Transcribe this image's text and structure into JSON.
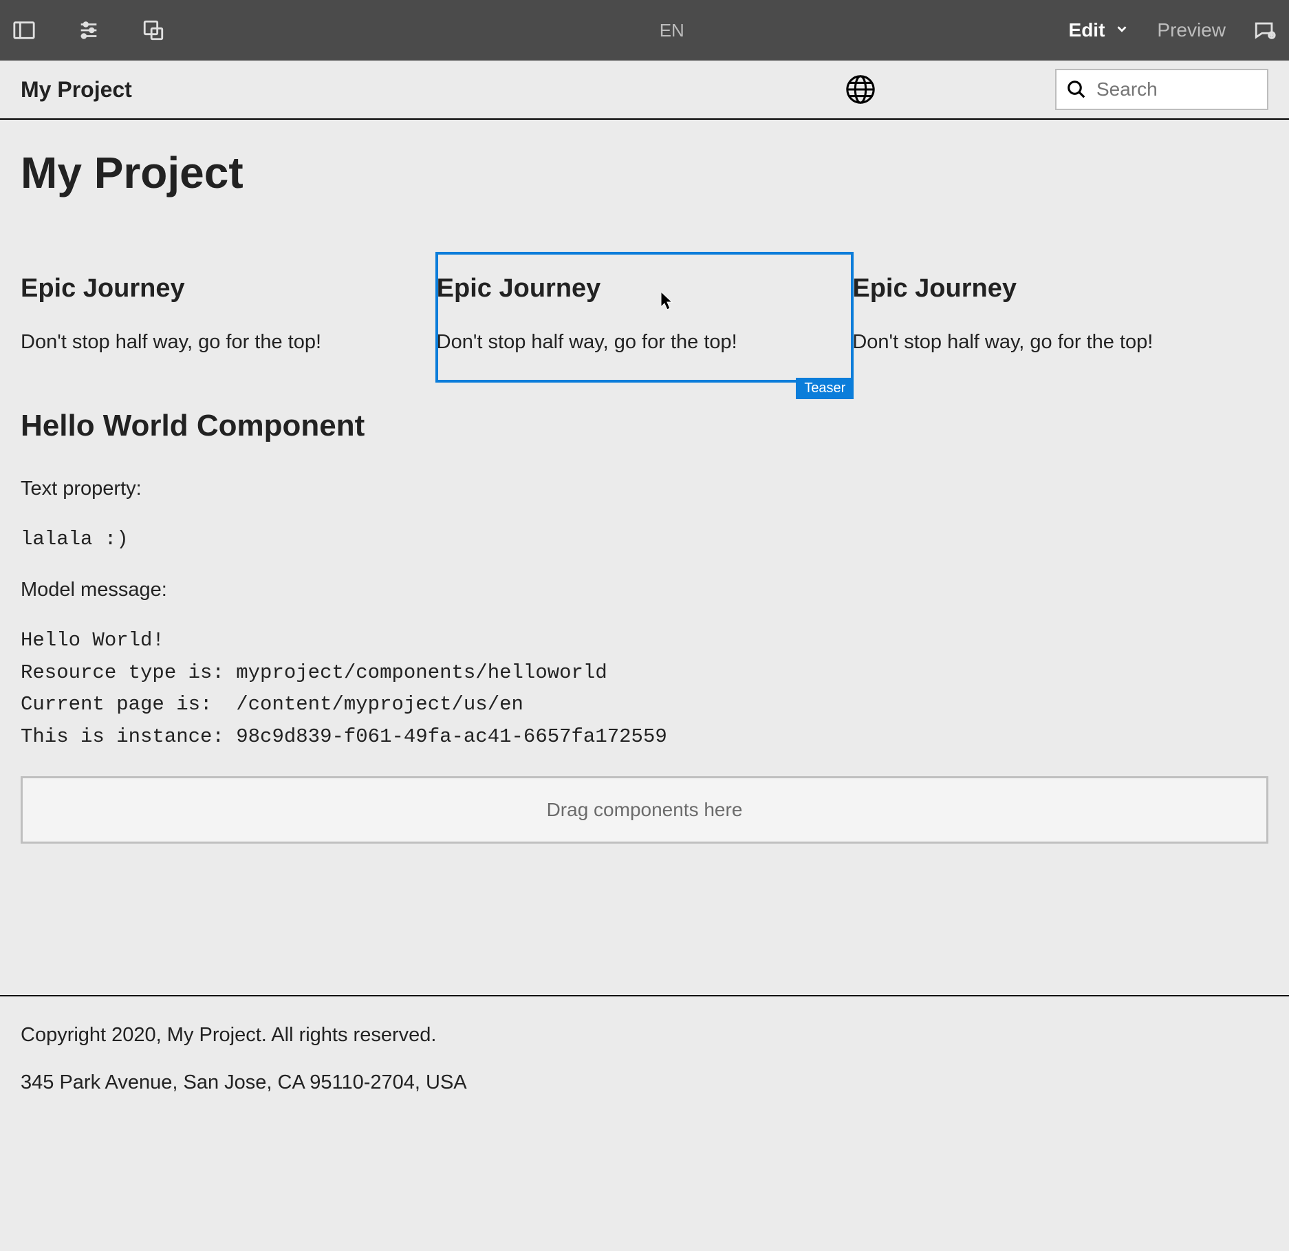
{
  "toolbar": {
    "lang": "EN",
    "edit_label": "Edit",
    "preview_label": "Preview"
  },
  "header": {
    "title": "My Project",
    "search_placeholder": "Search"
  },
  "page": {
    "title": "My Project",
    "teasers": [
      {
        "title": "Epic Journey",
        "text": "Don't stop half way, go for the top!"
      },
      {
        "title": "Epic Journey",
        "text": "Don't stop half way, go for the top!"
      },
      {
        "title": "Epic Journey",
        "text": "Don't stop half way, go for the top!"
      }
    ],
    "selected_component_label": "Teaser",
    "hello": {
      "heading": "Hello World Component",
      "text_label": "Text property:",
      "text_value": "lalala :)",
      "model_label": "Model message:",
      "model_value": "Hello World!\nResource type is: myproject/components/helloworld\nCurrent page is:  /content/myproject/us/en\nThis is instance: 98c9d839-f061-49fa-ac41-6657fa172559"
    },
    "dropzone_text": "Drag components here"
  },
  "footer": {
    "copyright": "Copyright 2020, My Project. All rights reserved.",
    "address": "345 Park Avenue, San Jose, CA 95110-2704, USA"
  }
}
